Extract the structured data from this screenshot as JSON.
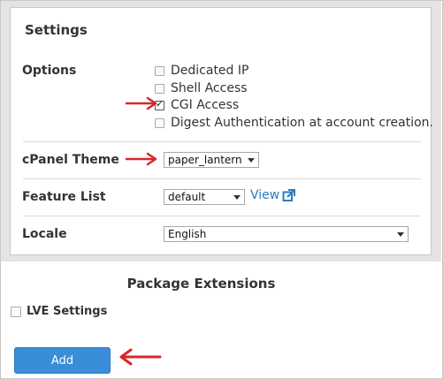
{
  "settings": {
    "title": "Settings",
    "options": {
      "label": "Options",
      "items": [
        {
          "label": "Dedicated IP",
          "checked": false
        },
        {
          "label": "Shell Access",
          "checked": false
        },
        {
          "label": "CGI Access",
          "checked": true
        },
        {
          "label": "Digest Authentication at account creation.",
          "checked": false
        }
      ]
    },
    "theme": {
      "label": "cPanel Theme",
      "value": "paper_lantern"
    },
    "feature_list": {
      "label": "Feature List",
      "value": "default",
      "view_link": "View"
    },
    "locale": {
      "label": "Locale",
      "value": "English"
    }
  },
  "extensions": {
    "title": "Package Extensions",
    "lve": {
      "label": "LVE Settings",
      "checked": false
    }
  },
  "add_button": {
    "label": "Add"
  },
  "colors": {
    "accent": "#3a8dd8",
    "annotation_arrow": "#d9262b",
    "link": "#2a7bbf"
  },
  "icons": {
    "external_link": "external-link-icon",
    "annotation": "red-arrow-icon"
  }
}
